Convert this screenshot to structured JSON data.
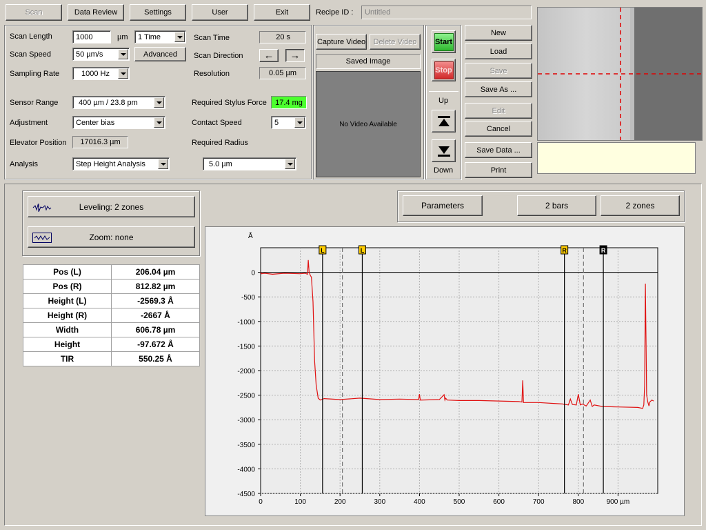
{
  "toolbar": {
    "scan": "Scan",
    "data_review": "Data Review",
    "settings": "Settings",
    "user": "User",
    "exit": "Exit"
  },
  "recipe": {
    "label": "Recipe ID :",
    "value": "Untitled"
  },
  "params": {
    "scan_length_label": "Scan Length",
    "scan_length_value": "1000",
    "scan_length_unit": "µm",
    "scan_times": "1 Time",
    "scan_speed_label": "Scan Speed",
    "scan_speed_value": "50 µm/s",
    "advanced": "Advanced",
    "sampling_rate_label": "Sampling Rate",
    "sampling_rate_value": "1000 Hz",
    "scan_time_label": "Scan Time",
    "scan_time_value": "20 s",
    "scan_direction_label": "Scan Direction",
    "resolution_label": "Resolution",
    "resolution_value": "0.05 µm",
    "sensor_range_label": "Sensor Range",
    "sensor_range_value": "400 µm / 23.8 pm",
    "adjustment_label": "Adjustment",
    "adjustment_value": "Center bias",
    "elevator_label": "Elevator Position",
    "elevator_value": "17016.3 µm",
    "analysis_label": "Analysis",
    "analysis_value": "Step Height Analysis",
    "stylus_force_label": "Required Stylus Force",
    "stylus_force_value": "17.4 mg",
    "contact_speed_label": "Contact Speed",
    "contact_speed_value": "5",
    "radius_label": "Required Radius",
    "radius_value": "5.0 µm"
  },
  "video": {
    "capture": "Capture Video",
    "delete": "Delete Video",
    "saved_image": "Saved Image",
    "no_video": "No Video Available"
  },
  "control": {
    "start": "Start",
    "stop": "Stop",
    "up": "Up",
    "down": "Down"
  },
  "recipe_buttons": {
    "new": "New",
    "load": "Load",
    "save": "Save",
    "save_as": "Save As ...",
    "edit": "Edit",
    "cancel": "Cancel",
    "save_data": "Save Data ...",
    "print": "Print"
  },
  "analysis_panel": {
    "leveling": "Leveling: 2 zones",
    "zoom": "Zoom: none",
    "parameters": "Parameters",
    "bars": "2 bars",
    "zones": "2 zones"
  },
  "results": [
    {
      "name": "Pos (L)",
      "value": "206.04 µm"
    },
    {
      "name": "Pos (R)",
      "value": "812.82 µm"
    },
    {
      "name": "Height (L)",
      "value": "-2569.3 Å"
    },
    {
      "name": "Height (R)",
      "value": "-2667 Å"
    },
    {
      "name": "Width",
      "value": "606.78 µm"
    },
    {
      "name": "Height",
      "value": "-97.672 Å"
    },
    {
      "name": "TIR",
      "value": "550.25 Å"
    }
  ],
  "colors": {
    "trace": "#e01010",
    "force_ok": "#4cff2e",
    "start": "#3fcc3f",
    "stop": "#e63a3a",
    "marker": "#ffcc00",
    "info_panel": "#ffffe0"
  },
  "chart_data": {
    "type": "line",
    "ylabel": "Å",
    "x_unit": "µm",
    "xlim": [
      0,
      1000
    ],
    "ylim": [
      -4500,
      500
    ],
    "x_ticks": [
      0,
      100,
      200,
      300,
      400,
      500,
      600,
      700,
      800,
      900
    ],
    "x_tick_labels": [
      "0",
      "100",
      "200",
      "300",
      "400",
      "500",
      "600",
      "700",
      "800",
      "900 µm"
    ],
    "y_ticks": [
      0,
      -500,
      -1000,
      -1500,
      -2000,
      -2500,
      -3000,
      -3500,
      -4000,
      -4500
    ],
    "y_tick_labels": [
      "0",
      "-500",
      "-1000",
      "-1500",
      "-2000",
      "-2500",
      "-3000",
      "-3500",
      "-4000",
      "-4500"
    ],
    "markers": [
      {
        "label": "L",
        "x": 156,
        "color": "#ffcc00"
      },
      {
        "label": "L",
        "x": 256,
        "color": "#ffcc00"
      },
      {
        "label": "R",
        "x": 765,
        "color": "#ffcc00"
      },
      {
        "label": "R",
        "x": 863,
        "color": "#000000"
      }
    ],
    "dashed_lines": [
      206,
      813
    ],
    "series": [
      {
        "x": [
          0,
          2,
          10,
          30,
          60,
          100,
          112,
          118,
          120,
          122,
          125,
          128,
          132,
          136,
          140,
          145,
          150,
          160,
          200,
          250,
          300,
          350,
          398,
          400,
          402,
          450,
          462,
          464,
          466,
          470,
          500,
          550,
          600,
          650,
          658,
          660,
          662,
          700,
          760,
          775,
          780,
          785,
          795,
          800,
          805,
          810,
          820,
          830,
          835,
          840,
          860,
          900,
          950,
          962,
          965,
          967,
          969,
          970,
          972,
          975,
          978,
          980,
          985,
          990
        ],
        "y": [
          0,
          -30,
          -20,
          -40,
          -20,
          -30,
          -20,
          -40,
          250,
          10,
          -60,
          -100,
          -600,
          -1800,
          -2300,
          -2560,
          -2600,
          -2570,
          -2590,
          -2560,
          -2590,
          -2580,
          -2590,
          -2480,
          -2600,
          -2590,
          -2490,
          -2600,
          -2560,
          -2600,
          -2610,
          -2610,
          -2620,
          -2630,
          -2640,
          -2200,
          -2650,
          -2650,
          -2680,
          -2700,
          -2580,
          -2690,
          -2700,
          -2480,
          -2700,
          -2680,
          -2720,
          -2600,
          -2730,
          -2700,
          -2730,
          -2740,
          -2750,
          -2770,
          -2700,
          -2300,
          -230,
          -1000,
          -2500,
          -2640,
          -2720,
          -2640,
          -2600,
          -2620
        ]
      }
    ]
  }
}
